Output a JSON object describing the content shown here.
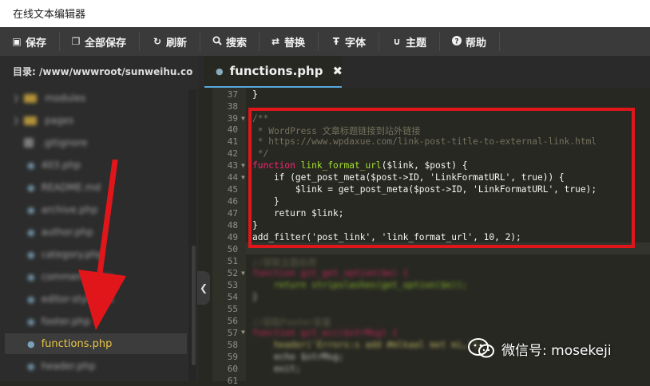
{
  "window": {
    "title": "在线文本编辑器"
  },
  "toolbar": {
    "buttons": [
      {
        "label": "保存",
        "icon": "floppy-icon"
      },
      {
        "label": "全部保存",
        "icon": "copy-icon"
      },
      {
        "label": "刷新",
        "icon": "refresh-icon"
      },
      {
        "label": "搜索",
        "icon": "search-icon"
      },
      {
        "label": "替换",
        "icon": "swap-icon"
      },
      {
        "label": "字体",
        "icon": "text-icon"
      },
      {
        "label": "主题",
        "icon": "magnet-icon"
      },
      {
        "label": "帮助",
        "icon": "help-icon"
      }
    ]
  },
  "sidebar": {
    "directory_label": "目录: /www/wwwroot/sunweihu.co...",
    "items": [
      {
        "label": "modules",
        "type": "folder"
      },
      {
        "label": "pages",
        "type": "folder"
      },
      {
        "label": ".gitignore",
        "type": "file"
      },
      {
        "label": "403.php",
        "type": "php"
      },
      {
        "label": "README.md",
        "type": "file"
      },
      {
        "label": "archive.php",
        "type": "php"
      },
      {
        "label": "author.php",
        "type": "php"
      },
      {
        "label": "category.php",
        "type": "php"
      },
      {
        "label": "comments.php",
        "type": "php"
      },
      {
        "label": "editor-style.css",
        "type": "php"
      },
      {
        "label": "footer.php",
        "type": "php"
      },
      {
        "label": "functions.php",
        "type": "php",
        "selected": true
      },
      {
        "label": "header.php",
        "type": "php"
      }
    ]
  },
  "editor": {
    "active_tab": "functions.php",
    "close_glyph": "✖",
    "line_numbers": [
      "37",
      "38",
      "39",
      "40",
      "41",
      "42",
      "43",
      "44",
      "45",
      "46",
      "47",
      "48",
      "49",
      "50",
      "51",
      "52",
      "53",
      "54",
      "55",
      "56",
      "57",
      "58",
      "59",
      "60",
      "61"
    ],
    "lines": {
      "l37": "}",
      "l39": "/**",
      "l40": " * WordPress 文章标题链接到站外链接",
      "l41": " * https://www.wpdaxue.com/link-post-title-to-external-link.html",
      "l42": " */",
      "l43_kw": "function",
      "l43_fn": "link_format_url",
      "l43_rest": "($link, $post) {",
      "l44": "    if (get_post_meta($post->ID, 'LinkFormatURL', true)) {",
      "l45": "        $link = get_post_meta($post->ID, 'LinkFormatURL', true);",
      "l46": "    }",
      "l47": "    return $link;",
      "l48": "}",
      "l49": "add_filter('post_link', 'link_format_url', 10, 2);",
      "l51": "//获取主题名称",
      "l52": "function git_get_option($e) {",
      "l53": "    return stripslashes(get_option($e));",
      "l54": "}",
      "l56": "//获取Footer变量",
      "l57": "function git_ecc($strMsg) {",
      "l58": "    header('Errors:s add #mlkaal met mi…');",
      "l59": "    echo $strMsg;",
      "l60": "    exit;",
      "l61": "}"
    }
  },
  "watermark": {
    "text": "微信号: mosekeji"
  },
  "colors": {
    "highlight_box": "#e0161b",
    "arrow": "#e0161b",
    "selected_file": "#e8c547"
  }
}
